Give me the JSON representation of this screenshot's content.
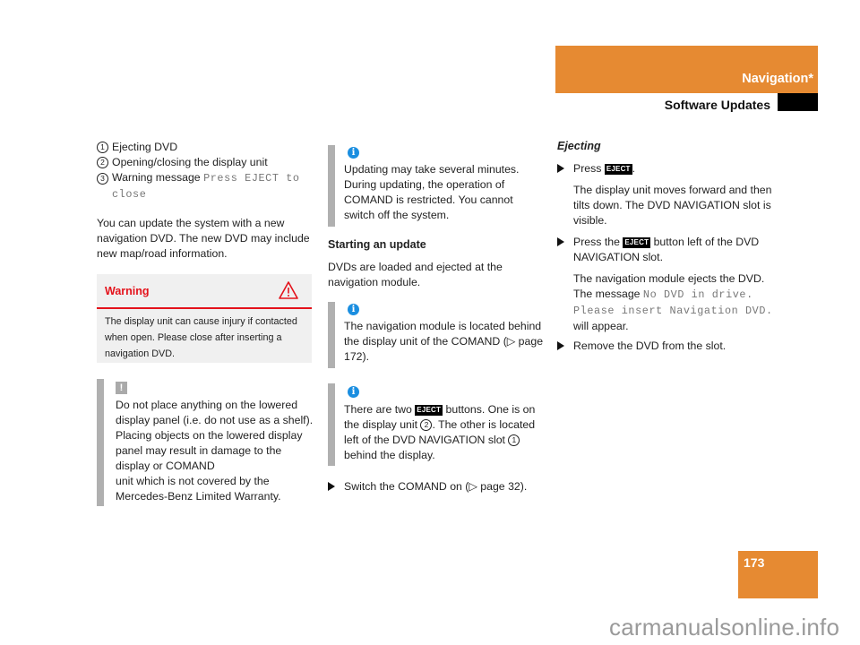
{
  "header": {
    "section": "Navigation*",
    "subsection": "Software Updates"
  },
  "page_number": "173",
  "watermark": "carmanualsonline.info",
  "col1": {
    "legend": [
      {
        "num": "1",
        "text": "Ejecting DVD"
      },
      {
        "num": "2",
        "text": "Opening/closing the display unit"
      },
      {
        "num": "3",
        "text": "Warning message ",
        "mono": "Press EJECT to close"
      }
    ],
    "intro": "You can update the system with a new navigation DVD. The new DVD may include new map/road information.",
    "warning": {
      "title": "Warning",
      "icon": "warning-triangle-icon",
      "text": "The display unit can cause injury if contacted when open. Please close after inserting a navigation DVD."
    },
    "caution": {
      "icon": "exclamation-icon",
      "text_lines": [
        "Do not place anything on the lowered display panel (i.e. do not use as a shelf). Placing objects on the lowered display panel may result in damage to the display or COMAND",
        "unit which is not covered by the Mercedes-Benz Limited Warranty."
      ]
    }
  },
  "col2": {
    "note1": {
      "icon": "info-icon",
      "text": "Updating may take several minutes. During updating, the operation of COMAND is restricted. You cannot switch off the system."
    },
    "heading": "Starting an update",
    "para": "DVDs are loaded and ejected at the navigation module.",
    "note2": {
      "icon": "info-icon",
      "text_a": "The navigation module is located behind the display unit of the COMAND (",
      "ref_arrow": "▷",
      "text_b": " page 172)."
    },
    "note3": {
      "icon": "info-icon",
      "text_a": "There are two ",
      "eject": "EJECT",
      "text_b": " buttons. One is on the display unit ",
      "num_a": "2",
      "text_c": ". The other is located left of the DVD NAVIGATION slot ",
      "num_b": "1",
      "text_d": " behind the display."
    },
    "step": {
      "text_a": "Switch the COMAND on (",
      "ref_arrow": "▷",
      "text_b": " page 32)."
    }
  },
  "col3": {
    "heading": "Ejecting",
    "steps": [
      {
        "text_a": "Press ",
        "eject": "EJECT",
        "text_b": ".",
        "result": "The display unit moves forward and then tilts down. The DVD NAVIGATION slot is visible."
      },
      {
        "text_a": "Press the ",
        "eject": "EJECT",
        "text_b": " button left of the DVD NAVIGATION slot.",
        "result_a": "The navigation module ejects the DVD. The message ",
        "result_mono": "No DVD in drive. Please insert Navigation DVD.",
        "result_b": " will appear."
      },
      {
        "text_a": "Remove the DVD from the slot."
      }
    ]
  }
}
